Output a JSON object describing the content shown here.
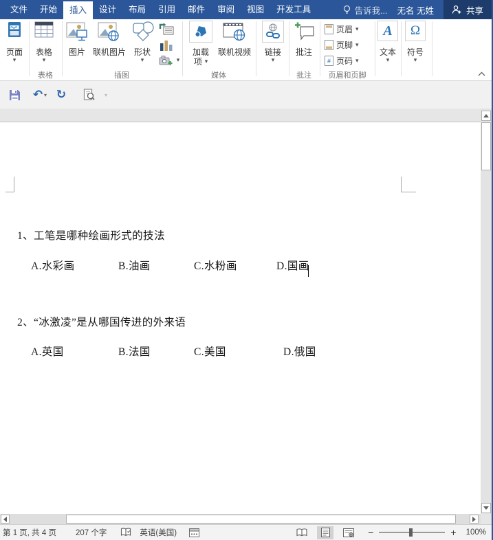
{
  "colors": {
    "accent": "#2b579a",
    "share_bg": "#1e3c6b",
    "doc_bg": "#e6e6e6"
  },
  "titlebar": {
    "tabs": [
      "文件",
      "开始",
      "插入",
      "设计",
      "布局",
      "引用",
      "邮件",
      "审阅",
      "视图",
      "开发工具"
    ],
    "active_tab": "插入",
    "tell_me": "告诉我...",
    "user": "无名 无姓",
    "share": "共享"
  },
  "ribbon": {
    "pages": {
      "label": "页面"
    },
    "tables": {
      "label": "表格",
      "group": "表格"
    },
    "illustrations": {
      "picture": "图片",
      "online_pictures": "联机图片",
      "shapes": "形状",
      "group": "插图"
    },
    "media": {
      "addins_line1": "加载",
      "addins_line2": "项",
      "online_video": "联机视频",
      "group": "媒体"
    },
    "links": {
      "label": "链接"
    },
    "comments": {
      "label": "批注",
      "group": "批注"
    },
    "header_footer": {
      "header": "页眉",
      "footer": "页脚",
      "page_number": "页码",
      "group": "页眉和页脚"
    },
    "text": {
      "label": "文本"
    },
    "symbols": {
      "label": "符号"
    }
  },
  "document": {
    "questions": [
      {
        "text": "1、工笔是哪种绘画形式的技法",
        "options": [
          "A.水彩画",
          "B.油画",
          "C.水粉画",
          "D.国画"
        ]
      },
      {
        "text": "2、“冰激凌”是从哪国传进的外来语",
        "options": [
          "A.英国",
          "B.法国",
          "C.美国",
          "D.俄国"
        ]
      }
    ]
  },
  "statusbar": {
    "page_info": "第 1 页, 共 4 页",
    "word_count": "207 个字",
    "language": "英语(美国)",
    "zoom_level": "100%"
  },
  "icons": {
    "dropdown": "▾",
    "undo_glyph": "↶",
    "redo_glyph": "↻",
    "minus": "−",
    "plus": "+"
  }
}
